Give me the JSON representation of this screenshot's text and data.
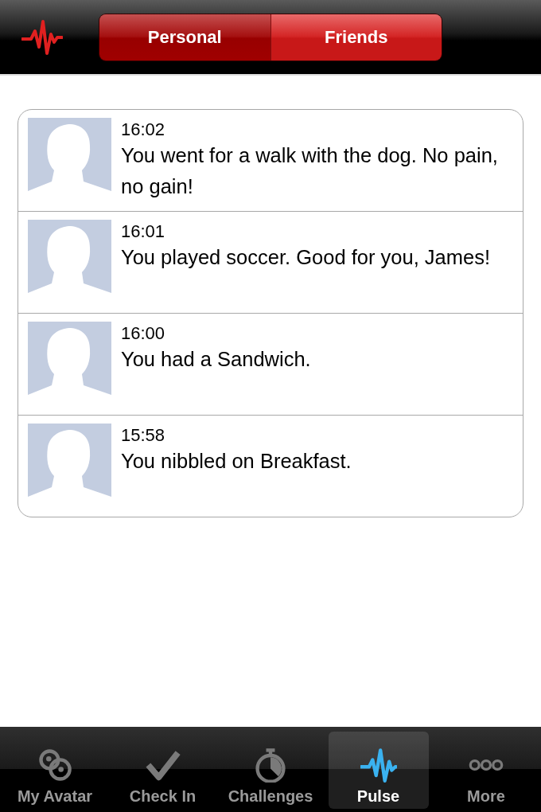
{
  "segments": [
    {
      "label": "Personal",
      "selected": true
    },
    {
      "label": "Friends",
      "selected": false
    }
  ],
  "feed": [
    {
      "time": "16:02",
      "text": "You went for a walk with the dog. No pain, no gain!"
    },
    {
      "time": "16:01",
      "text": "You played soccer. Good for you, James!"
    },
    {
      "time": "16:00",
      "text": "You had a Sandwich."
    },
    {
      "time": "15:58",
      "text": "You nibbled on Breakfast."
    }
  ],
  "tab_bar": [
    {
      "kind": "avatar",
      "label": "My Avatar",
      "selected": false
    },
    {
      "kind": "check",
      "label": "Check In",
      "selected": false
    },
    {
      "kind": "stopwatch",
      "label": "Challenges",
      "selected": false
    },
    {
      "kind": "pulse",
      "label": "Pulse",
      "selected": true
    },
    {
      "kind": "more",
      "label": "More",
      "selected": false
    }
  ]
}
